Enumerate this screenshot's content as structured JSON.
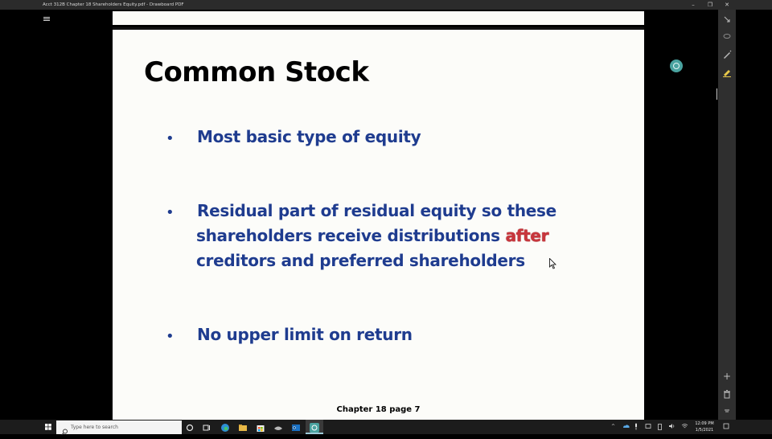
{
  "window": {
    "title": "Acct 312B Chapter 18 Shareholders Equity.pdf - Drawboard PDF",
    "minimize_glyph": "–",
    "restore_glyph": "❐",
    "close_glyph": "✕"
  },
  "slide": {
    "title": "Common Stock",
    "bullet_glyph": "•",
    "bullets": [
      {
        "lines": [
          "Most basic type of equity"
        ]
      },
      {
        "line1": "Residual part of residual equity so these",
        "line2_prefix": "shareholders receive distributions ",
        "emphasis": "after",
        "line3": "creditors and preferred shareholders"
      },
      {
        "lines": [
          "No upper limit on return"
        ]
      }
    ],
    "footer": "Chapter 18 page 7",
    "colors": {
      "bullet_text": "#1f3c8f",
      "emphasis": "#c8363c",
      "title": "#000000"
    }
  },
  "right_toolbar": {
    "tools": [
      "select-icon",
      "lasso-icon",
      "pen-icon",
      "highlighter-icon"
    ],
    "bottom_tools": [
      "add-page-icon",
      "delete-icon",
      "collapse-icon"
    ],
    "add_glyph": "+",
    "trash_glyph": "🗑",
    "collapse_glyph": "⌄"
  },
  "taskbar": {
    "search_placeholder": "Type here to search",
    "apps": [
      "cortana-icon",
      "task-view-icon",
      "edge-icon",
      "file-explorer-icon",
      "store-icon",
      "mail-icon",
      "outlook-icon",
      "drawboard-icon"
    ],
    "tray_chevron": "^",
    "time": "12:09 PM",
    "date": "1/5/2021"
  }
}
